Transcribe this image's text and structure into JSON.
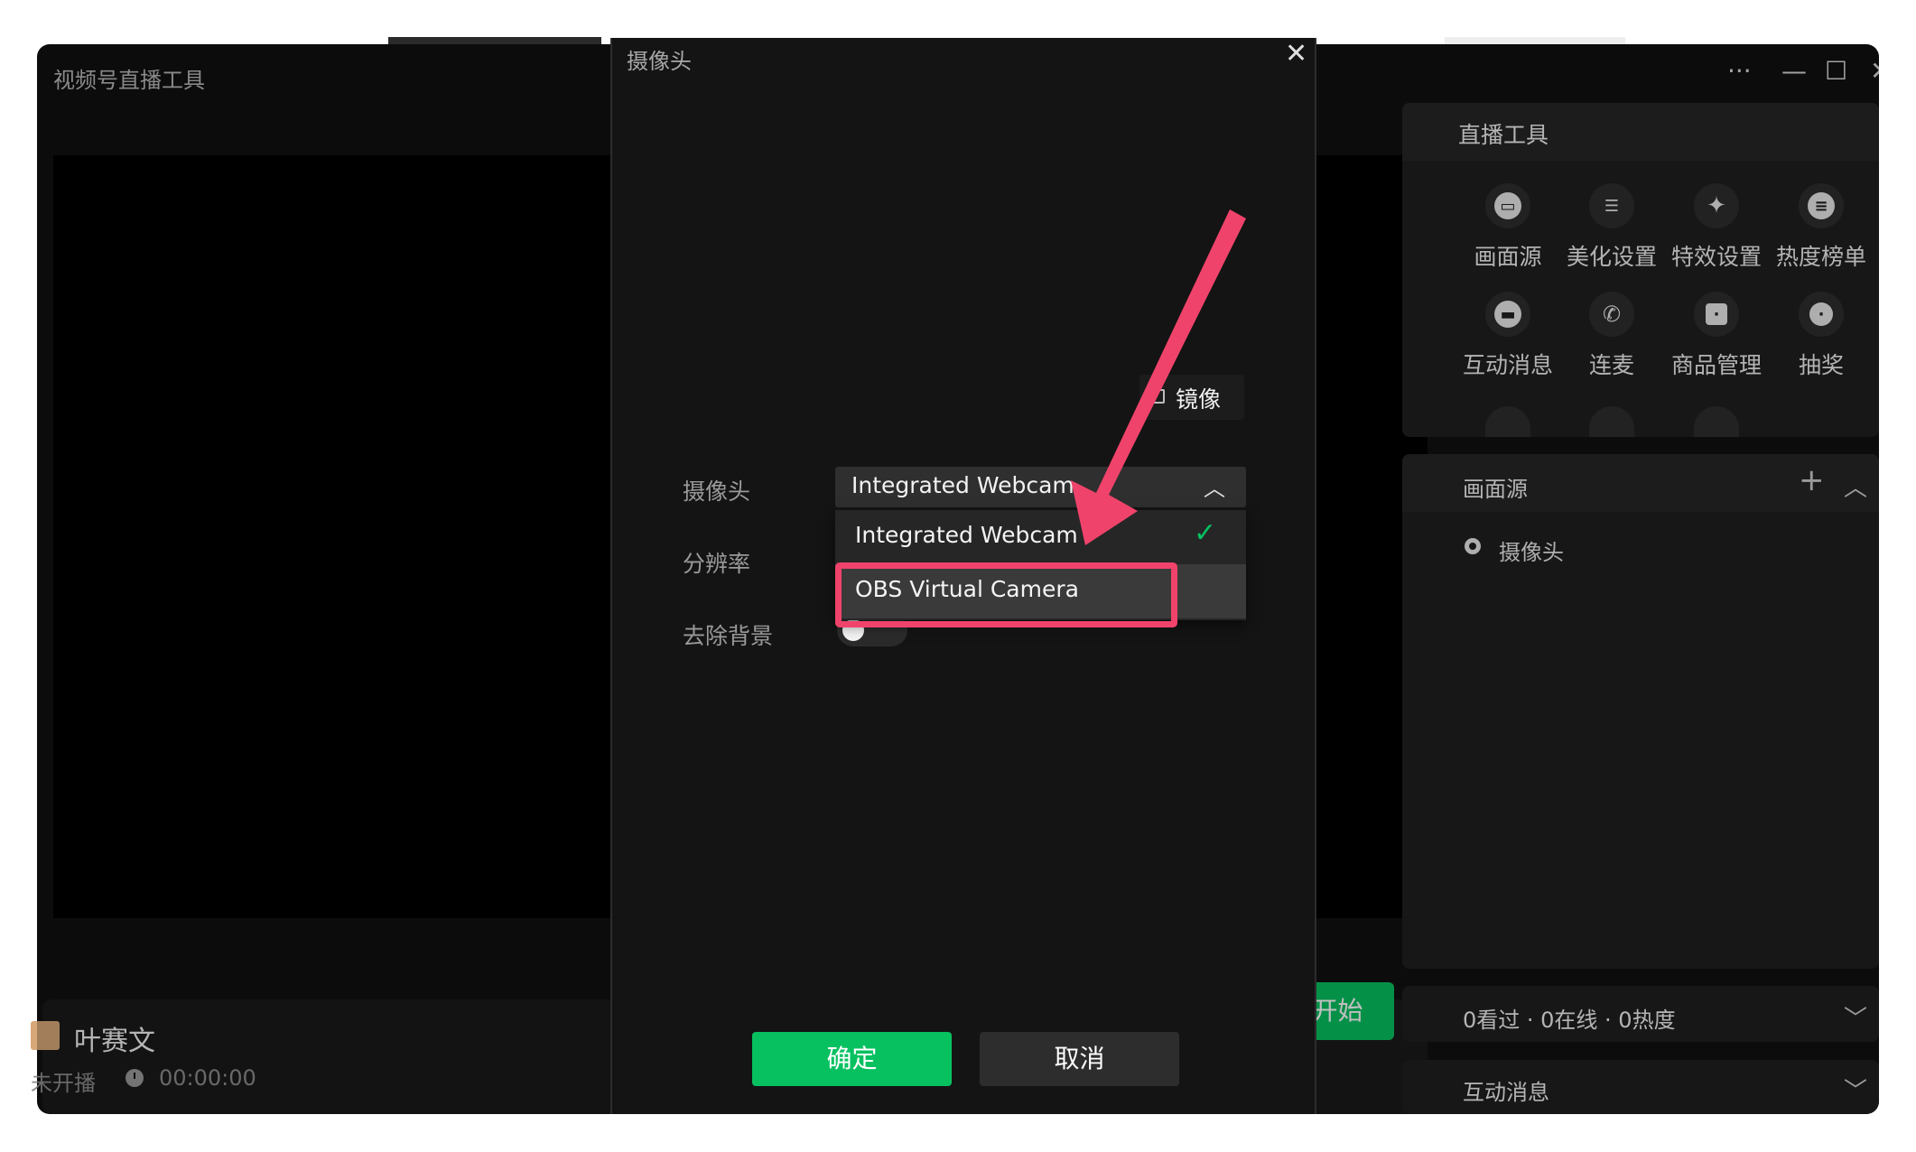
{
  "app": {
    "title": "视频号直播工具",
    "window_controls": {
      "more": "···",
      "minimize": "—",
      "maximize": "☐",
      "close": "✕"
    }
  },
  "footer": {
    "user_name": "叶赛文",
    "live_status": "未开播",
    "duration": "00:00:00",
    "start_button": "开始"
  },
  "sidebar": {
    "tools_title": "直播工具",
    "tools": [
      {
        "label": "画面源",
        "icon": "screen-source-icon"
      },
      {
        "label": "美化设置",
        "icon": "beauty-sliders-icon"
      },
      {
        "label": "特效设置",
        "icon": "sparkle-icon"
      },
      {
        "label": "热度榜单",
        "icon": "list-icon"
      },
      {
        "label": "互动消息",
        "icon": "message-icon"
      },
      {
        "label": "连麦",
        "icon": "phone-icon"
      },
      {
        "label": "商品管理",
        "icon": "shopping-bag-icon"
      },
      {
        "label": "抽奖",
        "icon": "lottery-icon"
      }
    ],
    "source_panel": {
      "title": "画面源",
      "add": "+",
      "collapse": "︿",
      "items": [
        {
          "label": "摄像头",
          "icon": "camera-pin-icon"
        }
      ]
    },
    "stats": {
      "text": "0看过 · 0在线 · 0热度",
      "chevron": "﹀"
    },
    "messages": {
      "title": "互动消息",
      "chevron": "﹀"
    }
  },
  "modal": {
    "title": "摄像头",
    "close": "✕",
    "mirror_label": "镜像",
    "fields": {
      "camera_label": "摄像头",
      "resolution_label": "分辨率",
      "remove_bg_label": "去除背景"
    },
    "camera_select": {
      "value": "Integrated Webcam",
      "caret": "︿",
      "options": [
        {
          "label": "Integrated Webcam",
          "selected": true
        },
        {
          "label": "OBS Virtual Camera",
          "selected": false
        }
      ],
      "check": "✓"
    },
    "remove_background_on": false,
    "confirm": "确定",
    "cancel": "取消"
  },
  "colors": {
    "accent": "#07c160",
    "annotation": "#f0436b",
    "background": "#111111"
  }
}
